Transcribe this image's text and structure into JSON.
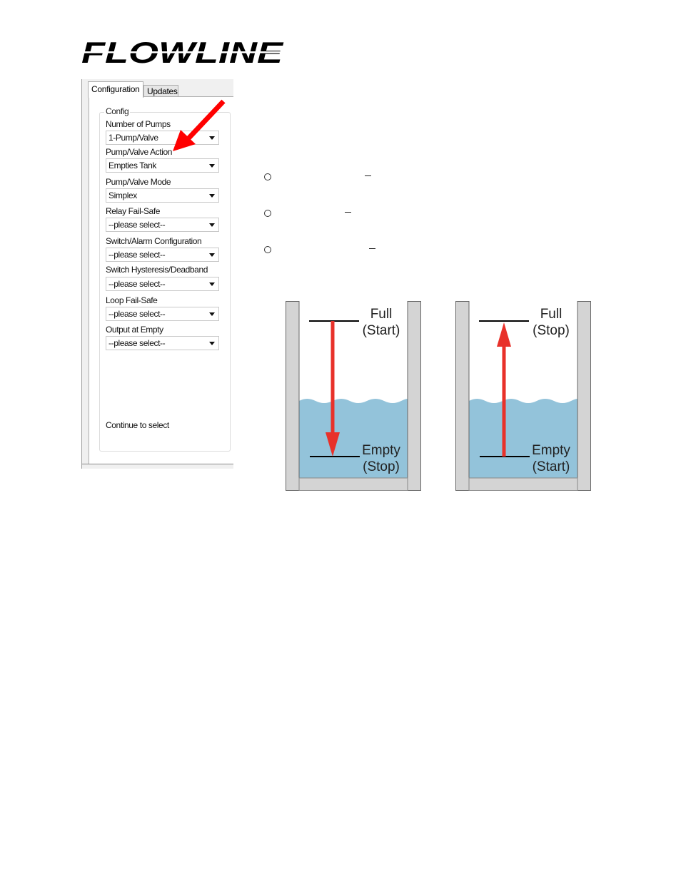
{
  "logo": {
    "text": "FLOWLINE"
  },
  "panel": {
    "tabs": [
      {
        "label": "Configuration",
        "active": true
      },
      {
        "label": "Updates",
        "active": false
      }
    ],
    "group_title": "Config",
    "fields": [
      {
        "label": "Number of Pumps",
        "value": "1-Pump/Valve"
      },
      {
        "label": "Pump/Valve Action",
        "value": "Empties Tank"
      },
      {
        "label": "Pump/Valve Mode",
        "value": "Simplex"
      },
      {
        "label": "Relay Fail-Safe",
        "value": "--please select--"
      },
      {
        "label": "Switch/Alarm Configuration",
        "value": "--please select--"
      },
      {
        "label": "Switch Hysteresis/Deadband",
        "value": "--please select--"
      },
      {
        "label": "Loop Fail-Safe",
        "value": "--please select--"
      },
      {
        "label": "Output at Empty",
        "value": "--please select--"
      }
    ],
    "footer_text": "Continue to select"
  },
  "annotation": {
    "arrow_color": "#ff0000",
    "points_to": "Pump/Valve Action"
  },
  "bullets": [
    {
      "marker": "circle",
      "dash": "–"
    },
    {
      "marker": "circle",
      "dash": "–"
    },
    {
      "marker": "circle",
      "dash": "–"
    }
  ],
  "tanks": [
    {
      "name": "empties-tank",
      "top_label": "Full",
      "top_sub": "(Start)",
      "bottom_label": "Empty",
      "bottom_sub": "(Stop)",
      "arrow_direction": "down"
    },
    {
      "name": "fills-tank",
      "top_label": "Full",
      "top_sub": "(Stop)",
      "bottom_label": "Empty",
      "bottom_sub": "(Start)",
      "arrow_direction": "up"
    }
  ],
  "colors": {
    "water": "#93c3da",
    "tank_wall": "#d4d4d4",
    "arrow": "#e8312a"
  }
}
